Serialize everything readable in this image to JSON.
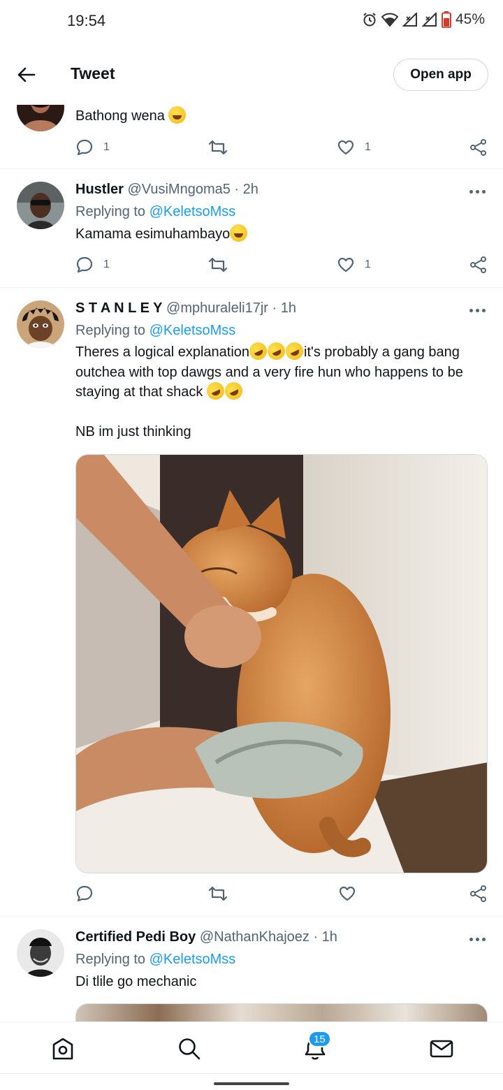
{
  "status_bar": {
    "time": "19:54",
    "battery": "45%"
  },
  "app_bar": {
    "title": "Tweet",
    "open_app": "Open app"
  },
  "tweets": [
    {
      "text": "Bathong wena",
      "reply_count": "1",
      "like_count": "1"
    },
    {
      "name": "Hustler",
      "handle": "@VusiMngoma5 · 2h",
      "replying_prefix": "Replying to ",
      "replying_to": "@KeletsoMss",
      "text": "Kamama  esimuhambayo",
      "reply_count": "1",
      "like_count": "1"
    },
    {
      "name": "S T A N L E Y",
      "handle": "@mphuraleli17jr · 1h",
      "replying_prefix": "Replying to ",
      "replying_to": "@KeletsoMss",
      "text_1": "Theres a logical explanation",
      "text_2": "it's probably a gang bang outchea with top dawgs and a very fire hun who happens to be staying at that shack ",
      "text_3": "NB im just thinking"
    },
    {
      "name": "Certified Pedi Boy",
      "handle": "@NathanKhajoez · 1h",
      "replying_prefix": "Replying to ",
      "replying_to": "@KeletsoMss",
      "text": "Di tlile go mechanic"
    }
  ],
  "bottom_nav": {
    "notifications_badge": "15"
  },
  "colors": {
    "accent": "#1d9bf0",
    "text": "#0f1419",
    "muted": "#536471"
  }
}
